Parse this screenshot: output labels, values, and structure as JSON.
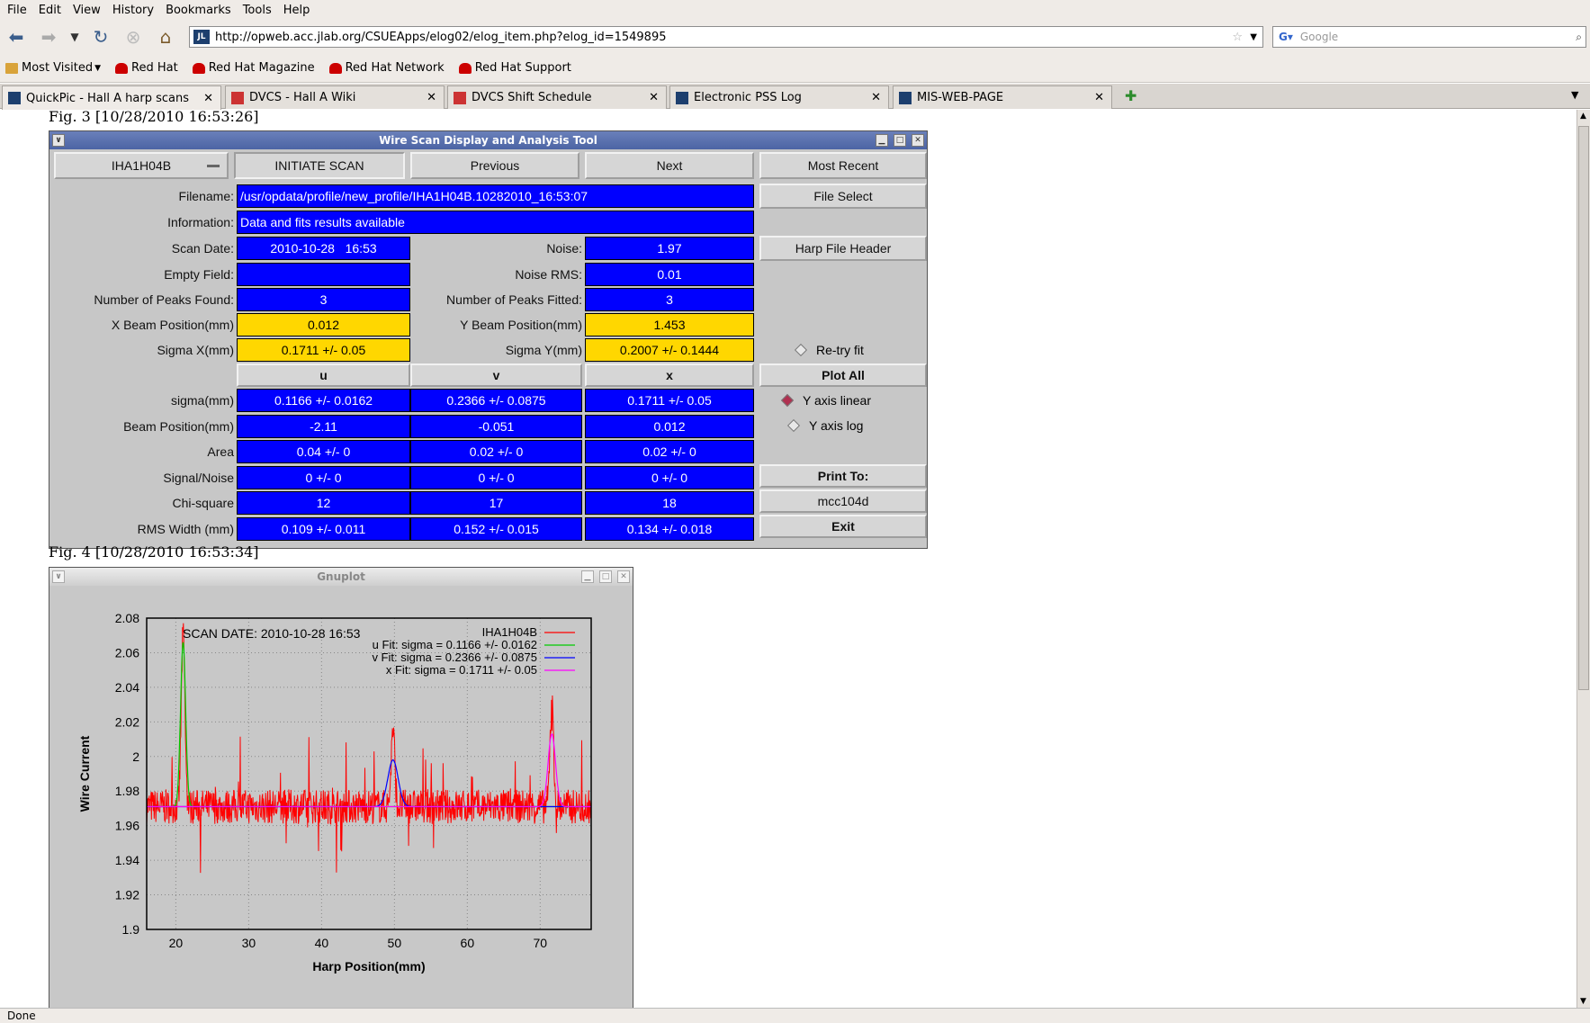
{
  "menu": [
    "File",
    "Edit",
    "View",
    "History",
    "Bookmarks",
    "Tools",
    "Help"
  ],
  "url": "http://opweb.acc.jlab.org/CSUEApps/elog02/elog_item.php?elog_id=1549895",
  "search_placeholder": "Google",
  "bookmarks": [
    "Most Visited",
    "Red Hat",
    "Red Hat Magazine",
    "Red Hat Network",
    "Red Hat Support"
  ],
  "tabs": [
    "QuickPic - Hall A harp scans",
    "DVCS - Hall A Wiki",
    "DVCS Shift Schedule",
    "Electronic PSS Log",
    "MIS-WEB-PAGE"
  ],
  "status": "Done",
  "fig3": {
    "caption": "Fig. 3 [10/28/2010 16:53:26]",
    "title": "Wire Scan Display and Analysis Tool",
    "harp_select": "IHA1H04B",
    "initiate": "INITIATE SCAN",
    "previous": "Previous",
    "next": "Next",
    "most_recent": "Most Recent",
    "filename_label": "Filename:",
    "filename": "/usr/opdata/profile/new_profile/IHA1H04B.10282010_16:53:07",
    "file_select": "File Select",
    "info_label": "Information:",
    "info": "Data and fits results available",
    "scan_date_label": "Scan Date:",
    "scan_date": "2010-10-28   16:53",
    "noise_label": "Noise:",
    "noise": "1.97",
    "harp_header": "Harp File Header",
    "empty_label": "Empty Field:",
    "noise_rms_label": "Noise RMS:",
    "noise_rms": "0.01",
    "peaks_found_label": "Number of Peaks Found:",
    "peaks_found": "3",
    "peaks_fitted_label": "Number of Peaks Fitted:",
    "peaks_fitted": "3",
    "xbeam_label": "X Beam Position(mm)",
    "xbeam": "0.012",
    "ybeam_label": "Y Beam Position(mm)",
    "ybeam": "1.453",
    "sigx_label": "Sigma X(mm)",
    "sigx": "0.1711 +/- 0.05",
    "sigy_label": "Sigma Y(mm)",
    "sigy": "0.2007 +/- 0.1444",
    "retry": "Re-try fit",
    "col_u": "u",
    "col_v": "v",
    "col_x": "x",
    "plot_all": "Plot All",
    "rows": [
      {
        "label": "sigma(mm)",
        "u": "0.1166 +/- 0.0162",
        "v": "0.2366 +/- 0.0875",
        "x": "0.1711 +/- 0.05"
      },
      {
        "label": "Beam Position(mm)",
        "u": "-2.11",
        "v": "-0.051",
        "x": "0.012"
      },
      {
        "label": "Area",
        "u": "0.04 +/- 0",
        "v": "0.02 +/- 0",
        "x": "0.02 +/- 0"
      },
      {
        "label": "Signal/Noise",
        "u": "0 +/- 0",
        "v": "0 +/- 0",
        "x": "0 +/- 0"
      },
      {
        "label": "Chi-square",
        "u": "12",
        "v": "17",
        "x": "18"
      },
      {
        "label": "RMS Width (mm)",
        "u": "0.109 +/- 0.011",
        "v": "0.152 +/- 0.015",
        "x": "0.134 +/- 0.018"
      }
    ],
    "yaxis_linear": "Y axis linear",
    "yaxis_log": "Y axis log",
    "print_to": "Print To:",
    "printer": "mcc104d",
    "exit": "Exit"
  },
  "fig4": {
    "caption": "Fig. 4 [10/28/2010 16:53:34]",
    "title": "Gnuplot"
  },
  "chart_data": {
    "type": "line",
    "xlabel": "Harp Position(mm)",
    "ylabel": "Wire Current",
    "xlim": [
      16,
      77
    ],
    "ylim": [
      1.9,
      2.08
    ],
    "xticks": [
      "20",
      "30",
      "40",
      "50",
      "60",
      "70"
    ],
    "yticks": [
      "1.9",
      "1.92",
      "1.94",
      "1.96",
      "1.98",
      "2",
      "2.02",
      "2.04",
      "2.06",
      "2.08"
    ],
    "annotation": "SCAN DATE: 2010-10-28   16:53",
    "grid": true,
    "legend_position": "top-right",
    "series": [
      {
        "name": "IHA1H04B",
        "color": "#ff0000",
        "baseline": 1.971,
        "noise": 0.01,
        "peaks": [
          {
            "x": 21,
            "y": 2.07
          },
          {
            "x": 49.8,
            "y": 2.015
          },
          {
            "x": 71.6,
            "y": 2.03
          }
        ]
      },
      {
        "name": "u  Fit: sigma = 0.1166 +/- 0.0162",
        "color": "#00cc00",
        "center": 21,
        "height": 0.095,
        "sigma": 0.1166
      },
      {
        "name": "v  Fit: sigma = 0.2366 +/- 0.0875",
        "color": "#0000ff",
        "center": 49.8,
        "height": 0.027,
        "sigma": 0.2366
      },
      {
        "name": "x  Fit: sigma = 0.1711 +/- 0.05",
        "color": "#ff00ff",
        "center": 71.6,
        "height": 0.042,
        "sigma": 0.1711
      }
    ]
  }
}
